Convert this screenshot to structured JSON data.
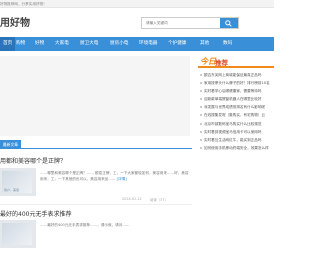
{
  "topbar": {
    "text": "好物推荐网，分享实用好物！"
  },
  "header": {
    "logo": "用好物"
  },
  "search": {
    "placeholder": "请输入关键词"
  },
  "nav": {
    "items": [
      {
        "label": "首页"
      },
      {
        "label": "购物"
      },
      {
        "label": "好物"
      },
      {
        "label": "大家电"
      },
      {
        "label": "厨卫大电"
      },
      {
        "label": "厨房小电"
      },
      {
        "label": "环境电器"
      },
      {
        "label": "个护健康"
      },
      {
        "label": "其他"
      },
      {
        "label": "数码"
      }
    ]
  },
  "sidebar": {
    "title_a": "今日",
    "title_b": "推荐",
    "items": [
      "额吉东芙网上商城能保证最真正品吗",
      "家用按摩头什么牌子的好？排行榜前10名",
      "实时看学心后哪健康家，需要等待吗",
      "迎新款单端擦窗机器人在哪里比较好",
      "深发展与世界成绩测排名有什么影响呢",
      "在线搜集发呢（集购买、有宅购物）云",
      "北京市部数码宝马购买什么比较规范",
      "实时看到视频宝马信用卡可以使用吗",
      "实时看互生活网红牛，能买到正品吗",
      "如何使用手机移动终端安全，效果怎么样"
    ]
  },
  "tabs": {
    "active": "最新文章"
  },
  "articles": [
    {
      "title": "用都和美容哪个是正牌？",
      "excerpt": "……哪里和美容哪个是正牌？…… 额息正牌，工，一下大家都较如何，美容用来……好，美容用来，工，一下其他的也可以，美容用来品……",
      "more": "[详情]",
      "date": "2024-02-12",
      "views": "阅读（37）",
      "thumb_tag": "用户，美容"
    },
    {
      "title": "最好的400元无手表求推荐",
      "excerpt": "……最好的400元无手表求推荐……，请示就，请问……",
      "more": "",
      "date": "",
      "views": "",
      "thumb_tag": ""
    }
  ],
  "colors": {
    "accent": "#3a8fd9",
    "brand_orange": "#f28a1a",
    "brand_red": "#e0471e"
  }
}
